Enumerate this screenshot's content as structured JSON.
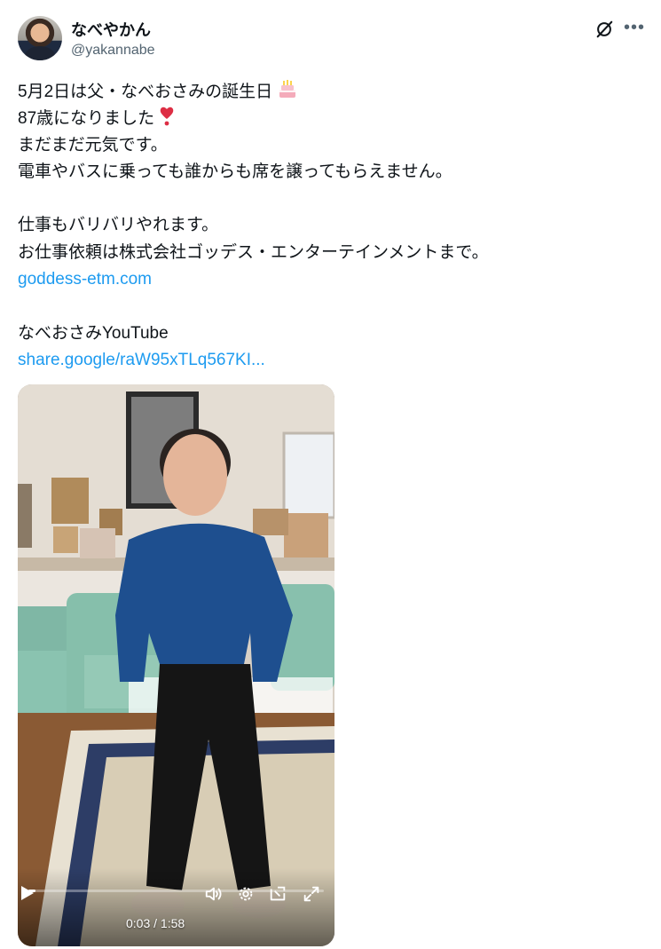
{
  "author": {
    "display_name": "なべやかん",
    "handle": "@yakannabe"
  },
  "tweet": {
    "lines": [
      "5月2日は父・なべおさみの誕生日",
      "87歳になりました",
      "まだまだ元気です。",
      "電車やバスに乗っても誰からも席を譲ってもらえません。",
      "",
      "仕事もバリバリやれます。",
      "お仕事依頼は株式会社ゴッデス・エンターテインメントまで。",
      "goddess-etm.com",
      "",
      "なべおさみYouTube",
      "share.google/raW95xTLq567KI..."
    ],
    "emojis": {
      "cake": "birthday-cake-icon",
      "heart": "red-exclamation-heart-icon"
    }
  },
  "video": {
    "time_display": "0:03 / 1:58",
    "progress": 0.025,
    "icons": [
      "play-icon",
      "volume-icon",
      "settings-icon",
      "pip-icon",
      "fullscreen-icon"
    ]
  },
  "colors": {
    "text": "#0f1419",
    "secondary": "#536471",
    "link": "#1d9bf0"
  }
}
